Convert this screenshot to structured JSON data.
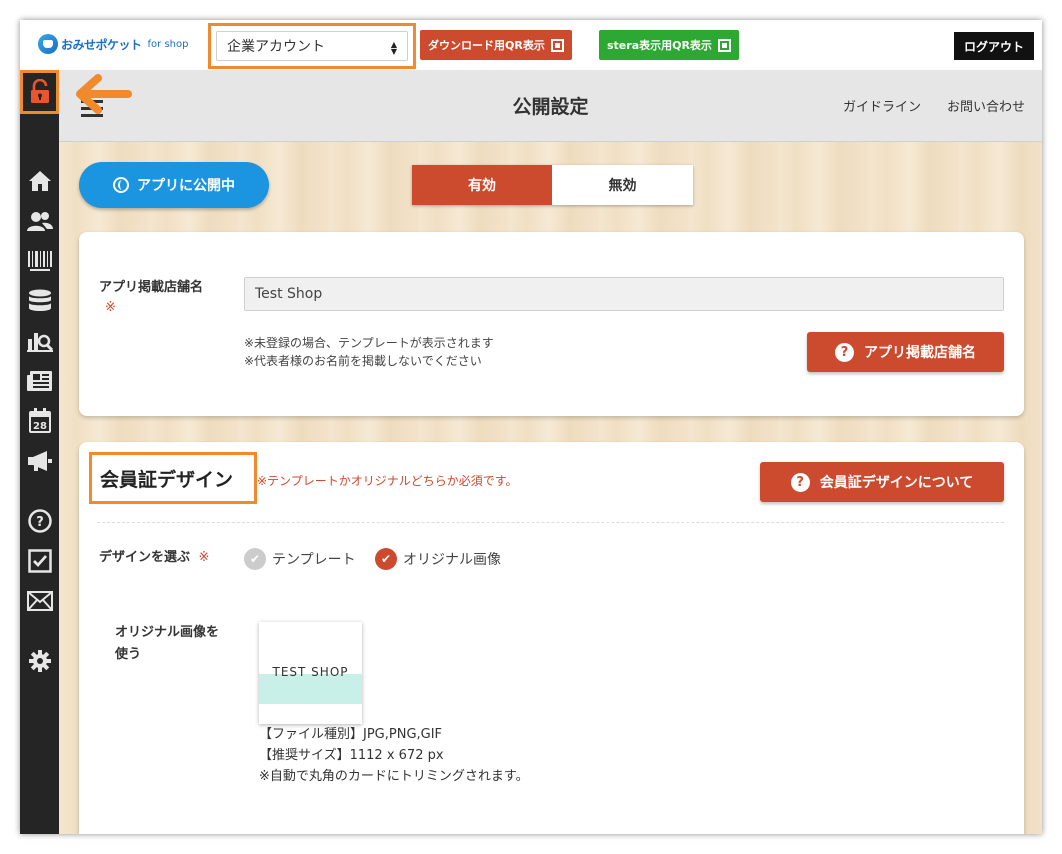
{
  "topbar": {
    "logo_brand": "おみせポケット",
    "logo_for": "for shop",
    "account_selected": "企業アカウント",
    "download_qr_label": "ダウンロード用QR表示",
    "stera_qr_label": "stera表示用QR表示",
    "logout_label": "ログアウト"
  },
  "header": {
    "title": "公開設定",
    "guideline": "ガイドライン",
    "contact": "お問い合わせ"
  },
  "publish": {
    "status_label": "アプリに公開中",
    "enabled_label": "有効",
    "disabled_label": "無効"
  },
  "shop_name": {
    "label": "アプリ掲載店舗名",
    "required_mark": "※",
    "value": "Test Shop",
    "note_line1": "※未登録の場合、テンプレートが表示されます",
    "note_line2": "※代表者様のお名前を掲載しないでください",
    "help_button": "アプリ掲載店舗名"
  },
  "member_card": {
    "title": "会員証デザイン",
    "required_note": "※テンプレートかオリジナルどちらか必須です。",
    "help_button": "会員証デザインについて",
    "choose_label": "デザインを選ぶ",
    "required_mark": "※",
    "option_template": "テンプレート",
    "option_original": "オリジナル画像",
    "selected_option": "オリジナル画像",
    "use_original_line1": "オリジナル画像を",
    "use_original_line2": "使う",
    "preview_name": "TEST SHOP",
    "file_type": "【ファイル種別】JPG,PNG,GIF",
    "recommended_size": "【推奨サイズ】1112 x 672 px",
    "trim_note": "※自動で丸角のカードにトリミングされます。"
  },
  "colors": {
    "accent": "#cc4a2e",
    "publish_blue": "#1c95e0",
    "stera_green": "#2da832",
    "highlight": "#f08a2c"
  },
  "sidebar": {
    "icons": [
      "unlock-icon",
      "home-icon",
      "users-icon",
      "barcode-icon",
      "database-icon",
      "analytics-icon",
      "news-icon",
      "calendar-icon",
      "megaphone-icon",
      "help-icon",
      "checkbox-icon",
      "mail-icon",
      "gear-icon"
    ]
  }
}
